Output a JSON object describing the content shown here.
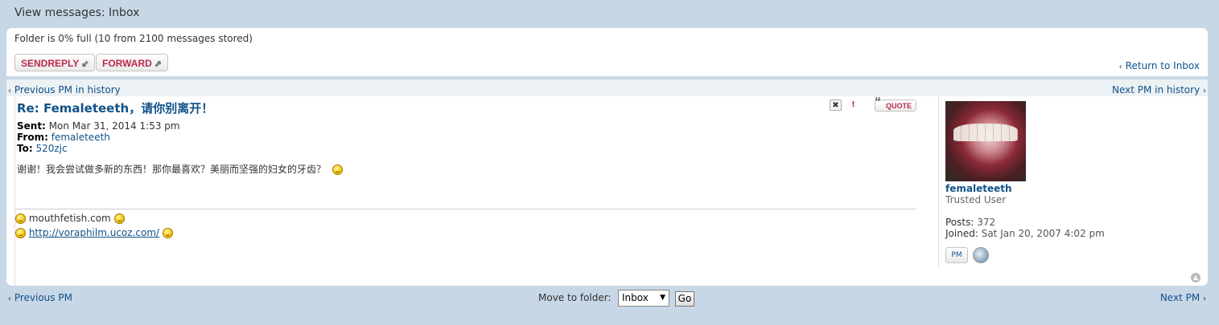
{
  "page_title": "View messages: Inbox",
  "folder_status": "Folder is 0% full (10 from 2100 messages stored)",
  "buttons": {
    "sendreply": "SENDREPLY",
    "forward": "FORWARD",
    "return_inbox": "Return to Inbox"
  },
  "history": {
    "prev": "Previous PM in history",
    "next": "Next PM in history"
  },
  "message": {
    "subject": "Re: Femaleteeth，请你别离开！",
    "sent_label": "Sent:",
    "sent_value": "Mon Mar 31, 2014 1:53 pm",
    "from_label": "From:",
    "from_value": "femaleteeth",
    "to_label": "To:",
    "to_value": "520zjc",
    "body": "谢谢！我会尝试做多新的东西！那你最喜欢？美丽而坚强的妇女的牙齿？",
    "quote_label": "QUOTE",
    "signature_text": "mouthfetish.com",
    "signature_link": "http://voraphilm.ucoz.com/"
  },
  "profile": {
    "name": "femaleteeth",
    "rank": "Trusted User",
    "posts_label": "Posts:",
    "posts_value": "372",
    "joined_label": "Joined:",
    "joined_value": "Sat Jan 20, 2007 4:02 pm",
    "pm_label": "PM"
  },
  "footer": {
    "prev_pm": "Previous PM",
    "next_pm": "Next PM",
    "move_label": "Move to folder:",
    "folder_selected": "Inbox",
    "go": "Go"
  },
  "colors": {
    "background": "#c8d7e6",
    "link": "#105289",
    "button_text": "#bc2a4d"
  }
}
